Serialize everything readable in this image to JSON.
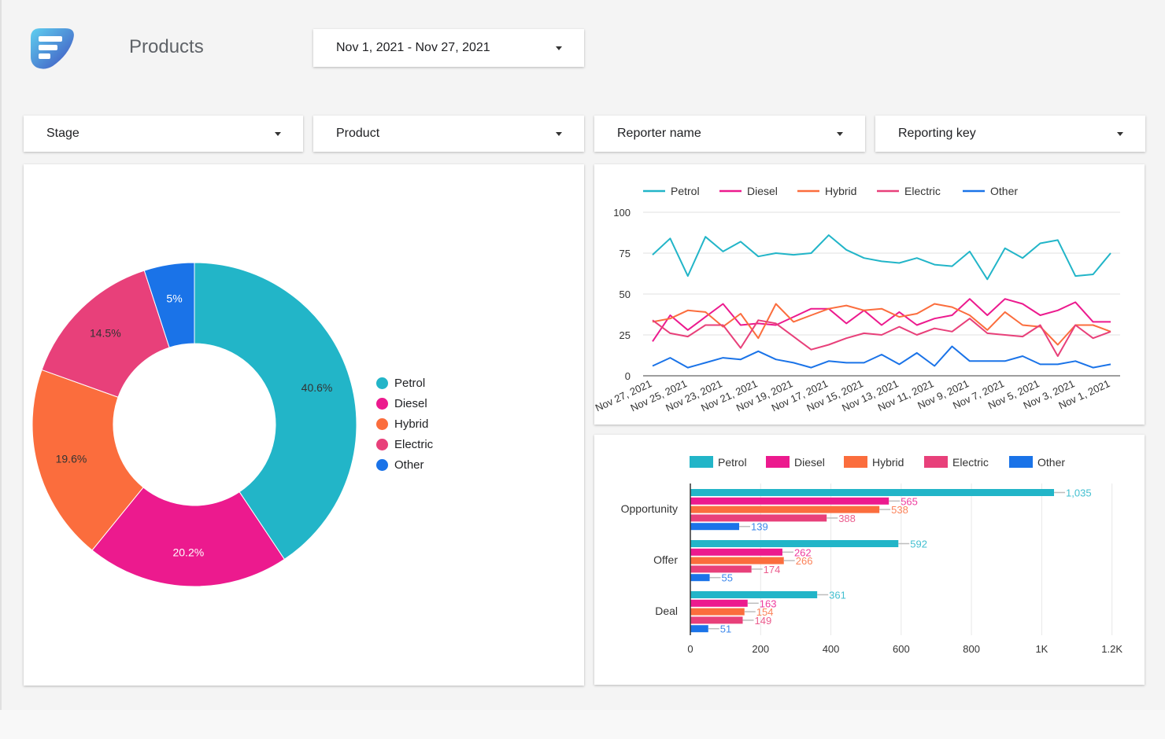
{
  "header": {
    "logo_icon": "f-logo-icon",
    "title": "Products",
    "date_range": "Nov 1, 2021 - Nov 27, 2021"
  },
  "filters": [
    {
      "label": "Stage"
    },
    {
      "label": "Product"
    },
    {
      "label": "Reporter name"
    },
    {
      "label": "Reporting key"
    }
  ],
  "colors": {
    "Petrol": "#22b5c8",
    "Diesel": "#ec1a8e",
    "Hybrid": "#fb6d3d",
    "Electric": "#e8407a",
    "Other": "#1a73e8"
  },
  "chart_data": [
    {
      "type": "pie",
      "variant": "donut",
      "legend_position": "right",
      "categories": [
        "Petrol",
        "Diesel",
        "Hybrid",
        "Electric",
        "Other"
      ],
      "values": [
        40.6,
        20.2,
        19.6,
        14.5,
        5
      ],
      "labels": [
        "40.6%",
        "20.2%",
        "19.6%",
        "14.5%",
        "5%"
      ]
    },
    {
      "type": "line",
      "legend_position": "top",
      "x": [
        "Nov 27, 2021",
        "Nov 26, 2021",
        "Nov 25, 2021",
        "Nov 24, 2021",
        "Nov 23, 2021",
        "Nov 22, 2021",
        "Nov 21, 2021",
        "Nov 20, 2021",
        "Nov 19, 2021",
        "Nov 18, 2021",
        "Nov 17, 2021",
        "Nov 16, 2021",
        "Nov 15, 2021",
        "Nov 14, 2021",
        "Nov 13, 2021",
        "Nov 12, 2021",
        "Nov 11, 2021",
        "Nov 10, 2021",
        "Nov 9, 2021",
        "Nov 8, 2021",
        "Nov 7, 2021",
        "Nov 6, 2021",
        "Nov 5, 2021",
        "Nov 4, 2021",
        "Nov 3, 2021",
        "Nov 2, 2021",
        "Nov 1, 2021"
      ],
      "xtick_labels": [
        "Nov 27, 2021",
        "Nov 25, 2021",
        "Nov 23, 2021",
        "Nov 21, 2021",
        "Nov 19, 2021",
        "Nov 17, 2021",
        "Nov 15, 2021",
        "Nov 13, 2021",
        "Nov 11, 2021",
        "Nov 9, 2021",
        "Nov 7, 2021",
        "Nov 5, 2021",
        "Nov 3, 2021",
        "Nov 1, 2021"
      ],
      "yticks": [
        0,
        25,
        50,
        75,
        100
      ],
      "ylim": [
        0,
        100
      ],
      "grid": true,
      "series": [
        {
          "name": "Petrol",
          "values": [
            74,
            84,
            61,
            85,
            76,
            82,
            73,
            75,
            74,
            75,
            86,
            77,
            72,
            70,
            69,
            72,
            68,
            67,
            76,
            59,
            78,
            72,
            81,
            83,
            61,
            62,
            75
          ]
        },
        {
          "name": "Diesel",
          "values": [
            21,
            37,
            28,
            36,
            44,
            31,
            32,
            31,
            36,
            41,
            41,
            32,
            40,
            31,
            39,
            31,
            35,
            37,
            47,
            37,
            47,
            44,
            37,
            40,
            45,
            33,
            33
          ]
        },
        {
          "name": "Hybrid",
          "values": [
            33,
            35,
            40,
            39,
            30,
            38,
            23,
            44,
            33,
            37,
            41,
            43,
            40,
            41,
            36,
            38,
            44,
            42,
            37,
            28,
            39,
            31,
            30,
            19,
            31,
            31,
            27
          ]
        },
        {
          "name": "Electric",
          "values": [
            34,
            26,
            24,
            31,
            31,
            17,
            34,
            32,
            24,
            16,
            19,
            23,
            26,
            25,
            30,
            25,
            29,
            27,
            35,
            26,
            25,
            24,
            31,
            12,
            31,
            23,
            27
          ]
        },
        {
          "name": "Other",
          "values": [
            6,
            11,
            5,
            8,
            11,
            10,
            15,
            10,
            8,
            5,
            9,
            8,
            8,
            13,
            7,
            14,
            6,
            18,
            9,
            9,
            9,
            12,
            7,
            7,
            9,
            5,
            7
          ]
        }
      ]
    },
    {
      "type": "bar",
      "orientation": "horizontal",
      "legend_position": "top",
      "categories": [
        "Opportunity",
        "Offer",
        "Deal"
      ],
      "xticks": [
        0,
        200,
        400,
        600,
        800,
        1000,
        1200
      ],
      "xtick_labels": [
        "0",
        "200",
        "400",
        "600",
        "800",
        "1K",
        "1.2K"
      ],
      "xlim": [
        0,
        1250
      ],
      "grid": true,
      "series": [
        {
          "name": "Petrol",
          "values": [
            1035,
            592,
            361
          ],
          "labels": [
            "1,035",
            "592",
            "361"
          ]
        },
        {
          "name": "Diesel",
          "values": [
            565,
            262,
            163
          ],
          "labels": [
            "565",
            "262",
            "163"
          ]
        },
        {
          "name": "Hybrid",
          "values": [
            538,
            266,
            154
          ],
          "labels": [
            "538",
            "266",
            "154"
          ]
        },
        {
          "name": "Electric",
          "values": [
            388,
            174,
            149
          ],
          "labels": [
            "388",
            "174",
            "149"
          ]
        },
        {
          "name": "Other",
          "values": [
            139,
            55,
            51
          ],
          "labels": [
            "139",
            "55",
            "51"
          ]
        }
      ]
    }
  ]
}
